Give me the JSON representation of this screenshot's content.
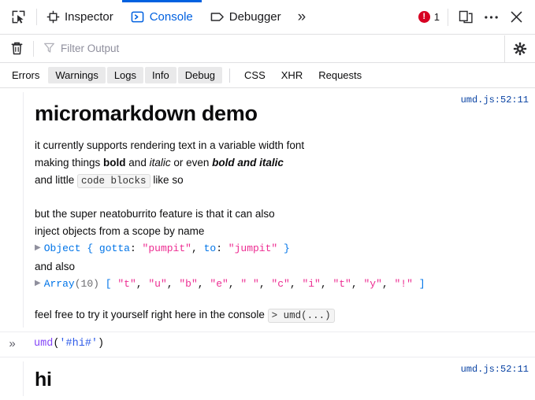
{
  "toolbar": {
    "picker_title": "Pick an element from the page",
    "tabs": [
      {
        "label": "Inspector",
        "icon": "inspector-icon",
        "active": false
      },
      {
        "label": "Console",
        "icon": "console-icon",
        "active": true
      },
      {
        "label": "Debugger",
        "icon": "debugger-icon",
        "active": false
      }
    ],
    "overflow_label": "»",
    "error_count": "1",
    "responsive_icon": "responsive-design-mode-icon",
    "meatball_label": "•••",
    "close_label": "✕"
  },
  "filterbar": {
    "clear_icon": "trash-icon",
    "filter_icon": "funnel-icon",
    "filter_value": "",
    "filter_placeholder": "Filter Output",
    "settings_icon": "gear-icon"
  },
  "severity_filters": [
    {
      "label": "Errors",
      "active": false
    },
    {
      "label": "Warnings",
      "active": true
    },
    {
      "label": "Logs",
      "active": true
    },
    {
      "label": "Info",
      "active": true
    },
    {
      "label": "Debug",
      "active": true
    }
  ],
  "category_filters": [
    {
      "label": "CSS",
      "active": false
    },
    {
      "label": "XHR",
      "active": false
    },
    {
      "label": "Requests",
      "active": false
    }
  ],
  "messages": [
    {
      "source_link": "umd.js:52:11",
      "heading": "micromarkdown demo",
      "para1": "it currently supports rendering text in a variable width font",
      "para2_pre": "making things ",
      "para2_bold": "bold",
      "para2_mid1": " and ",
      "para2_italic": "italic",
      "para2_mid2": " or even ",
      "para2_bolditalic": "bold and italic",
      "para3_pre": "and little ",
      "para3_code": "code blocks",
      "para3_post": " like so",
      "para4": "but the super neatoburrito feature is that it can also",
      "para5": "inject objects from a scope by name",
      "object_preview": {
        "type": "Object",
        "open": " { ",
        "entries": [
          {
            "key": "gotta",
            "sep": ": ",
            "value": "\"pumpit\""
          },
          {
            "key": "to",
            "sep": ": ",
            "value": "\"jumpit\""
          }
        ],
        "comma": ", ",
        "close": " }"
      },
      "para6": "and also",
      "array_preview": {
        "type": "Array",
        "length": "(10)",
        "open": " [ ",
        "items": [
          "\"t\"",
          "\"u\"",
          "\"b\"",
          "\"e\"",
          "\" \"",
          "\"c\"",
          "\"i\"",
          "\"t\"",
          "\"y\"",
          "\"!\""
        ],
        "comma": ", ",
        "close": " ]"
      },
      "para7_pre": "feel free to try it yourself right here in the console ",
      "para7_code": "> umd(...)"
    }
  ],
  "input": {
    "prompt": "»",
    "fn": "umd",
    "open_paren": "(",
    "arg": "'#hi#'",
    "close_paren": ")"
  },
  "result": {
    "source_link": "umd.js:52:11",
    "heading": "hi"
  },
  "colors": {
    "accent": "#0061e0",
    "error": "#d70022",
    "link": "#0842a3",
    "token_object": "#0074e8",
    "token_string": "#ed2d92",
    "token_function": "#8445f7",
    "token_argstring": "#2e5be8",
    "filter_active_bg": "#e9e9ea"
  }
}
